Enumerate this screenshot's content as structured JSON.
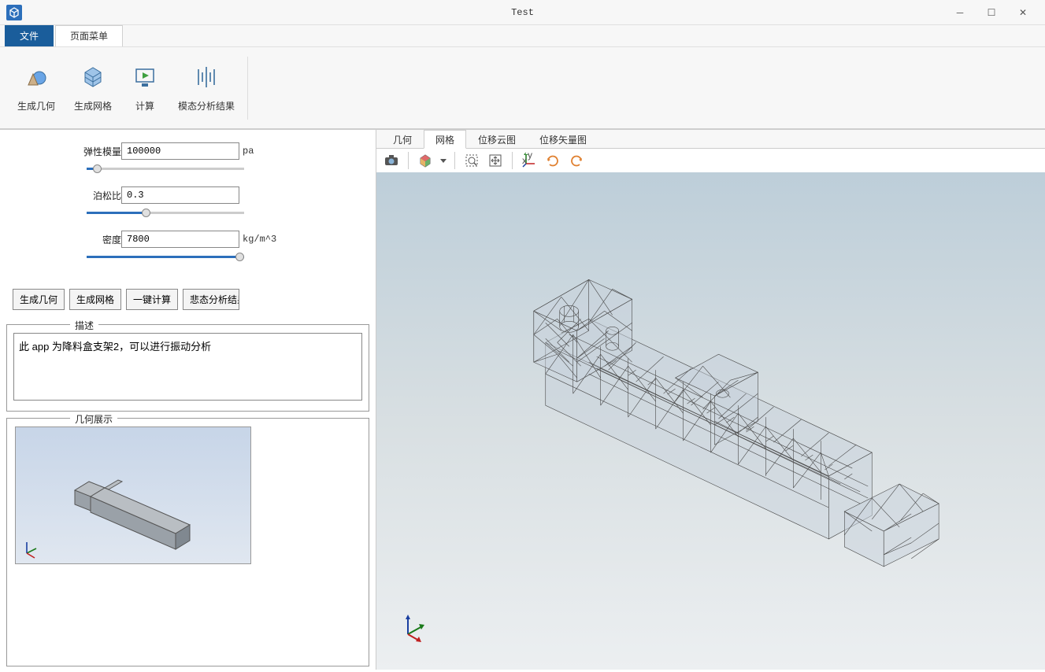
{
  "window": {
    "title": "Test"
  },
  "menu_tabs": {
    "file": "文件",
    "page": "页面菜单"
  },
  "ribbon": {
    "gen_geom": "生成几何",
    "gen_mesh": "生成网格",
    "calc": "计算",
    "modal": "模态分析结果"
  },
  "properties": {
    "elastic": {
      "label": "弹性模量",
      "value": "100000",
      "unit": "pa"
    },
    "poisson": {
      "label": "泊松比",
      "value": "0.3",
      "unit": ""
    },
    "density": {
      "label": "密度",
      "value": "7800",
      "unit": "kg/m^3"
    }
  },
  "actions": {
    "gen_geom": "生成几何",
    "gen_mesh": "生成网格",
    "one_calc": "一键计算",
    "modal_res": "悲态分析结果"
  },
  "description": {
    "legend": "描述",
    "text": "此 app 为降料盒支架2，可以进行振动分析"
  },
  "geometry_preview": {
    "legend": "几何展示"
  },
  "view_tabs": {
    "geom": "几何",
    "mesh": "网格",
    "disp_cloud": "位移云图",
    "disp_vec": "位移矢量图"
  }
}
